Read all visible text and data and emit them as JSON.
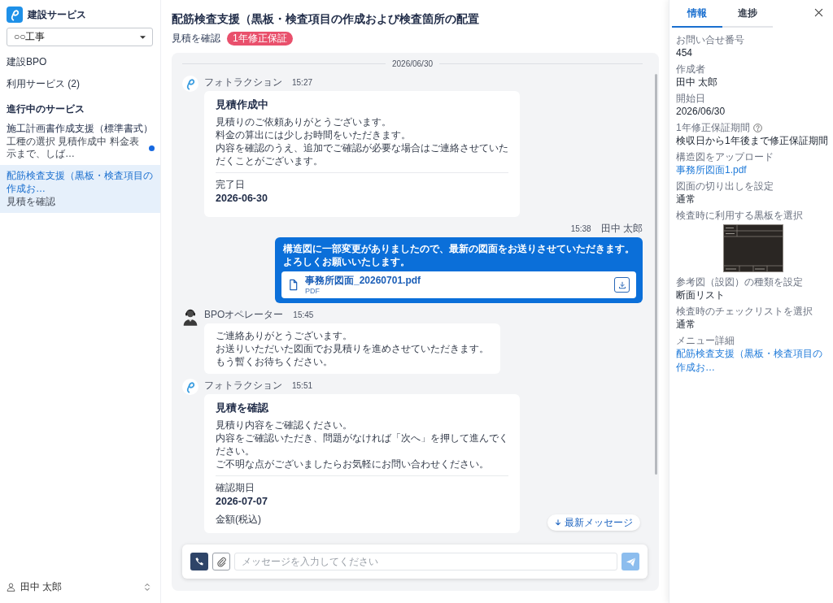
{
  "sidebar": {
    "brand": "建設サービス",
    "project": "○○工事",
    "nav": [
      "建設BPO",
      "利用サービス (2)"
    ],
    "section_title": "進行中のサービス",
    "services": [
      {
        "title": "施工計画書作成支援（標準書式）",
        "subtitle": "工種の選択 見積作成中 料金表示まで、しば…",
        "unread": true,
        "selected": false
      },
      {
        "title": "配筋検査支援（黒板・検査項目の作成お…",
        "subtitle": "見積を確認",
        "selected": true
      }
    ],
    "user": "田中 太郎"
  },
  "header": {
    "title": "配筋検査支援（黒板・検査項目の作成および検査箇所の配置",
    "status": "見積を確認",
    "badge": "1年修正保証"
  },
  "chat": {
    "date_divider": "2026/06/30",
    "messages": [
      {
        "kind": "card",
        "avatar": {
          "kind": "logo"
        },
        "sender": "フォトラクション",
        "time": "15:27",
        "title": "見積作成中",
        "body": [
          "見積りのご依頼ありがとうございます。",
          "料金の算出には少しお時間をいただきます。",
          "内容を確認のうえ、追加でご確認が必要な場合はご連絡させていただくことがございます。"
        ],
        "fields": [
          {
            "label": "完了日",
            "value": "2026-06-30"
          }
        ]
      },
      {
        "kind": "own",
        "sender": "田中 太郎",
        "time": "15:38",
        "body": [
          "構造図に一部変更がありましたので、最新の図面をお送りさせていただきます。",
          "よろしくお願いいたします。"
        ],
        "attachment": {
          "name": "事務所図面_20260701.pdf",
          "type": "PDF"
        }
      },
      {
        "kind": "text",
        "avatar": {
          "kind": "operator"
        },
        "sender": "BPOオペレーター",
        "time": "15:45",
        "body": [
          "ご連絡ありがとうございます。",
          "お送りいただいた図面でお見積りを進めさせていただきます。",
          "もう暫くお待ちください。"
        ]
      },
      {
        "kind": "card",
        "avatar": {
          "kind": "logo"
        },
        "sender": "フォトラクション",
        "time": "15:51",
        "title": "見積を確認",
        "body": [
          "見積り内容をご確認ください。",
          "内容をご確認いただき、問題がなければ「次へ」を押して進んでください。",
          "ご不明な点がございましたらお気軽にお問い合わせください。"
        ],
        "fields": [
          {
            "label": "確認期日",
            "value": "2026-07-07"
          },
          {
            "label": "金額(税込)"
          }
        ]
      }
    ],
    "jump_button": "最新メッセージ",
    "composer": {
      "placeholder": "メッセージを入力してください"
    }
  },
  "detail_panel": {
    "tabs": [
      {
        "label": "情報",
        "selected": true
      },
      {
        "label": "進捗",
        "selected": false
      }
    ],
    "fields": [
      {
        "kind": "text",
        "label": "お問い合せ番号",
        "value": "454"
      },
      {
        "kind": "text",
        "label": "作成者",
        "value": "田中 太郎"
      },
      {
        "kind": "text",
        "label": "開始日",
        "value": "2026/06/30"
      },
      {
        "kind": "text",
        "label": "1年修正保証期間",
        "help": true,
        "value": "検収日から1年後まで修正保証期間"
      },
      {
        "kind": "link",
        "label": "構造図をアップロード",
        "value": "事務所図面1.pdf"
      },
      {
        "kind": "text",
        "label": "図面の切り出しを設定",
        "value": "通常"
      },
      {
        "kind": "image",
        "label": "検査時に利用する黒板を選択"
      },
      {
        "kind": "text",
        "label": "参考図（設図）の種類を設定",
        "value": "断面リスト"
      },
      {
        "kind": "text",
        "label": "検査時のチェックリストを選択",
        "value": "通常"
      },
      {
        "kind": "link",
        "label": "メニュー詳細",
        "value": "配筋検査支援（黒板・検査項目の作成お…"
      }
    ]
  }
}
